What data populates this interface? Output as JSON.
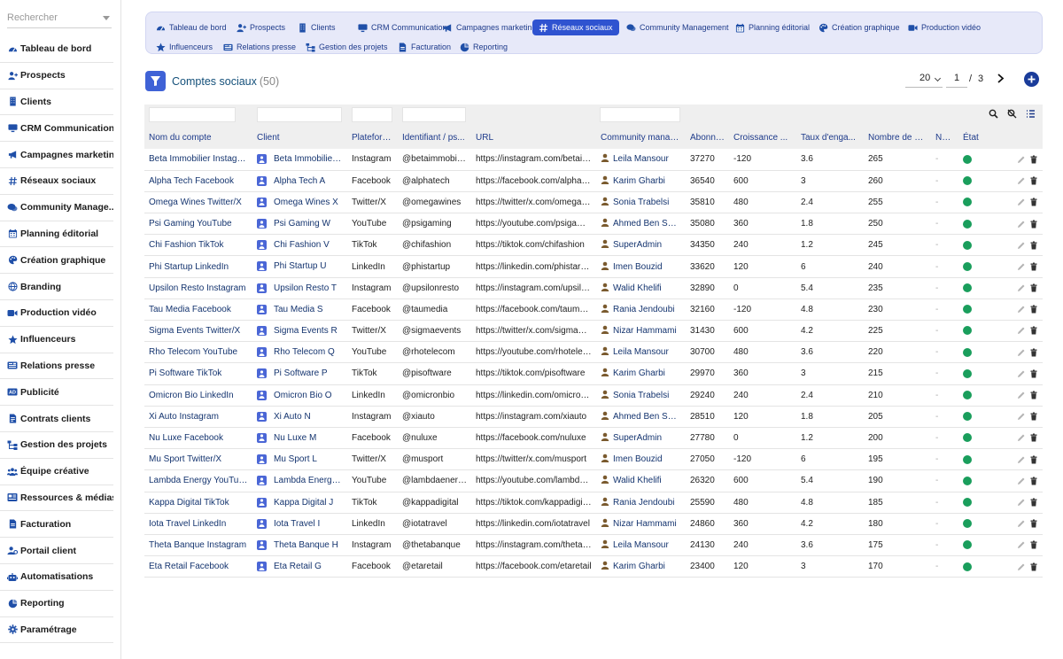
{
  "sidebar": {
    "search_placeholder": "Rechercher",
    "items": [
      {
        "label": "Tableau de bord",
        "icon": "dashboard-icon"
      },
      {
        "label": "Prospects",
        "icon": "user-plus-icon"
      },
      {
        "label": "Clients",
        "icon": "building-icon"
      },
      {
        "label": "CRM Communication",
        "icon": "monitor-icon"
      },
      {
        "label": "Campagnes marketing",
        "icon": "megaphone-icon"
      },
      {
        "label": "Réseaux sociaux",
        "icon": "hashtag-icon"
      },
      {
        "label": "Community Manage...",
        "icon": "chat-icon"
      },
      {
        "label": "Planning éditorial",
        "icon": "calendar-icon"
      },
      {
        "label": "Création graphique",
        "icon": "palette-icon"
      },
      {
        "label": "Branding",
        "icon": "globe-icon"
      },
      {
        "label": "Production vidéo",
        "icon": "video-icon"
      },
      {
        "label": "Influenceurs",
        "icon": "star-icon"
      },
      {
        "label": "Relations presse",
        "icon": "newspaper-icon"
      },
      {
        "label": "Publicité",
        "icon": "ad-icon"
      },
      {
        "label": "Contrats clients",
        "icon": "contract-icon"
      },
      {
        "label": "Gestion des projets",
        "icon": "project-icon"
      },
      {
        "label": "Équipe créative",
        "icon": "team-icon"
      },
      {
        "label": "Ressources & médias",
        "icon": "media-icon"
      },
      {
        "label": "Facturation",
        "icon": "invoice-icon"
      },
      {
        "label": "Portail client",
        "icon": "portal-icon"
      },
      {
        "label": "Automatisations",
        "icon": "robot-icon"
      },
      {
        "label": "Reporting",
        "icon": "chart-pie-icon"
      },
      {
        "label": "Paramétrage",
        "icon": "gear-icon"
      }
    ]
  },
  "modules": [
    {
      "label": "Tableau de bord",
      "icon": "dashboard-icon",
      "active": false
    },
    {
      "label": "Prospects",
      "icon": "user-plus-icon",
      "active": false
    },
    {
      "label": "Clients",
      "icon": "building-icon",
      "active": false
    },
    {
      "label": "CRM Communication",
      "icon": "monitor-icon",
      "active": false
    },
    {
      "label": "Campagnes marketing",
      "icon": "megaphone-icon",
      "active": false
    },
    {
      "label": "Réseaux sociaux",
      "icon": "hashtag-icon",
      "active": true
    },
    {
      "label": "Community Management",
      "icon": "chat-icon",
      "active": false
    },
    {
      "label": "Planning éditorial",
      "icon": "calendar-icon",
      "active": false
    },
    {
      "label": "Création graphique",
      "icon": "palette-icon",
      "active": false
    },
    {
      "label": "Production vidéo",
      "icon": "video-icon",
      "active": false
    },
    {
      "label": "Influenceurs",
      "icon": "star-icon",
      "active": false
    },
    {
      "label": "Relations presse",
      "icon": "newspaper-icon",
      "active": false
    },
    {
      "label": "Gestion des projets",
      "icon": "project-icon",
      "active": false
    },
    {
      "label": "Facturation",
      "icon": "invoice-icon",
      "active": false
    },
    {
      "label": "Reporting",
      "icon": "chart-pie-icon",
      "active": false
    }
  ],
  "header": {
    "title": "Comptes sociaux",
    "count": "(50)"
  },
  "pager": {
    "page_size": "20",
    "current_page": "1",
    "separator": "/",
    "total_pages": "3"
  },
  "table": {
    "columns": [
      "Nom du compte",
      "Client",
      "Plateforme",
      "Identifiant / ps...",
      "URL",
      "Community manager",
      "Abonnés",
      "Croissance ...",
      "Taux d'enga...",
      "Nombre de p...",
      "Note",
      "État"
    ],
    "rows": [
      {
        "name": "Beta Immobilier Instagram",
        "client": "Beta Immobilier B",
        "platform": "Instagram",
        "handle": "@betaimmobilier",
        "url": "https://instagram.com/betaimmobilier",
        "manager": "Leila Mansour",
        "followers": "37270",
        "growth": "-120",
        "engagement": "3.6",
        "posts": "265",
        "note": "-"
      },
      {
        "name": "Alpha Tech Facebook",
        "client": "Alpha Tech A",
        "platform": "Facebook",
        "handle": "@alphatech",
        "url": "https://facebook.com/alphatech",
        "manager": "Karim Gharbi",
        "followers": "36540",
        "growth": "600",
        "engagement": "3",
        "posts": "260",
        "note": "-"
      },
      {
        "name": "Omega Wines Twitter/X",
        "client": "Omega Wines X",
        "platform": "Twitter/X",
        "handle": "@omegawines",
        "url": "https://twitter/x.com/omegawines",
        "manager": "Sonia Trabelsi",
        "followers": "35810",
        "growth": "480",
        "engagement": "2.4",
        "posts": "255",
        "note": "-"
      },
      {
        "name": "Psi Gaming YouTube",
        "client": "Psi Gaming W",
        "platform": "YouTube",
        "handle": "@psigaming",
        "url": "https://youtube.com/psigaming",
        "manager": "Ahmed Ben Salah",
        "followers": "35080",
        "growth": "360",
        "engagement": "1.8",
        "posts": "250",
        "note": "-"
      },
      {
        "name": "Chi Fashion TikTok",
        "client": "Chi Fashion V",
        "platform": "TikTok",
        "handle": "@chifashion",
        "url": "https://tiktok.com/chifashion",
        "manager": "SuperAdmin",
        "followers": "34350",
        "growth": "240",
        "engagement": "1.2",
        "posts": "245",
        "note": "-"
      },
      {
        "name": "Phi Startup LinkedIn",
        "client": "Phi Startup U",
        "platform": "LinkedIn",
        "handle": "@phistartup",
        "url": "https://linkedin.com/phistartup",
        "manager": "Imen Bouzid",
        "followers": "33620",
        "growth": "120",
        "engagement": "6",
        "posts": "240",
        "note": "-"
      },
      {
        "name": "Upsilon Resto Instagram",
        "client": "Upsilon Resto T",
        "platform": "Instagram",
        "handle": "@upsilonresto",
        "url": "https://instagram.com/upsilonresto",
        "manager": "Walid Khelifi",
        "followers": "32890",
        "growth": "0",
        "engagement": "5.4",
        "posts": "235",
        "note": "-"
      },
      {
        "name": "Tau Media Facebook",
        "client": "Tau Media S",
        "platform": "Facebook",
        "handle": "@taumedia",
        "url": "https://facebook.com/taumedia",
        "manager": "Rania Jendoubi",
        "followers": "32160",
        "growth": "-120",
        "engagement": "4.8",
        "posts": "230",
        "note": "-"
      },
      {
        "name": "Sigma Events Twitter/X",
        "client": "Sigma Events R",
        "platform": "Twitter/X",
        "handle": "@sigmaevents",
        "url": "https://twitter/x.com/sigmaevents",
        "manager": "Nizar Hammami",
        "followers": "31430",
        "growth": "600",
        "engagement": "4.2",
        "posts": "225",
        "note": "-"
      },
      {
        "name": "Rho Telecom YouTube",
        "client": "Rho Telecom Q",
        "platform": "YouTube",
        "handle": "@rhotelecom",
        "url": "https://youtube.com/rhotelecom",
        "manager": "Leila Mansour",
        "followers": "30700",
        "growth": "480",
        "engagement": "3.6",
        "posts": "220",
        "note": "-"
      },
      {
        "name": "Pi Software TikTok",
        "client": "Pi Software P",
        "platform": "TikTok",
        "handle": "@pisoftware",
        "url": "https://tiktok.com/pisoftware",
        "manager": "Karim Gharbi",
        "followers": "29970",
        "growth": "360",
        "engagement": "3",
        "posts": "215",
        "note": "-"
      },
      {
        "name": "Omicron Bio LinkedIn",
        "client": "Omicron Bio O",
        "platform": "LinkedIn",
        "handle": "@omicronbio",
        "url": "https://linkedin.com/omicronbio",
        "manager": "Sonia Trabelsi",
        "followers": "29240",
        "growth": "240",
        "engagement": "2.4",
        "posts": "210",
        "note": "-"
      },
      {
        "name": "Xi Auto Instagram",
        "client": "Xi Auto N",
        "platform": "Instagram",
        "handle": "@xiauto",
        "url": "https://instagram.com/xiauto",
        "manager": "Ahmed Ben Salah",
        "followers": "28510",
        "growth": "120",
        "engagement": "1.8",
        "posts": "205",
        "note": "-"
      },
      {
        "name": "Nu Luxe Facebook",
        "client": "Nu Luxe M",
        "platform": "Facebook",
        "handle": "@nuluxe",
        "url": "https://facebook.com/nuluxe",
        "manager": "SuperAdmin",
        "followers": "27780",
        "growth": "0",
        "engagement": "1.2",
        "posts": "200",
        "note": "-"
      },
      {
        "name": "Mu Sport Twitter/X",
        "client": "Mu Sport L",
        "platform": "Twitter/X",
        "handle": "@musport",
        "url": "https://twitter/x.com/musport",
        "manager": "Imen Bouzid",
        "followers": "27050",
        "growth": "-120",
        "engagement": "6",
        "posts": "195",
        "note": "-"
      },
      {
        "name": "Lambda Energy YouTube",
        "client": "Lambda Energy K",
        "platform": "YouTube",
        "handle": "@lambdaenergy",
        "url": "https://youtube.com/lambdaenergy",
        "manager": "Walid Khelifi",
        "followers": "26320",
        "growth": "600",
        "engagement": "5.4",
        "posts": "190",
        "note": "-"
      },
      {
        "name": "Kappa Digital TikTok",
        "client": "Kappa Digital J",
        "platform": "TikTok",
        "handle": "@kappadigital",
        "url": "https://tiktok.com/kappadigital",
        "manager": "Rania Jendoubi",
        "followers": "25590",
        "growth": "480",
        "engagement": "4.8",
        "posts": "185",
        "note": "-"
      },
      {
        "name": "Iota Travel LinkedIn",
        "client": "Iota Travel I",
        "platform": "LinkedIn",
        "handle": "@iotatravel",
        "url": "https://linkedin.com/iotatravel",
        "manager": "Nizar Hammami",
        "followers": "24860",
        "growth": "360",
        "engagement": "4.2",
        "posts": "180",
        "note": "-"
      },
      {
        "name": "Theta Banque Instagram",
        "client": "Theta Banque H",
        "platform": "Instagram",
        "handle": "@thetabanque",
        "url": "https://instagram.com/thetabanque",
        "manager": "Leila Mansour",
        "followers": "24130",
        "growth": "240",
        "engagement": "3.6",
        "posts": "175",
        "note": "-"
      },
      {
        "name": "Eta Retail Facebook",
        "client": "Eta Retail G",
        "platform": "Facebook",
        "handle": "@etaretail",
        "url": "https://facebook.com/etaretail",
        "manager": "Karim Gharbi",
        "followers": "23400",
        "growth": "120",
        "engagement": "3",
        "posts": "170",
        "note": "-"
      }
    ]
  },
  "colors": {
    "accent": "#2f53d0",
    "link": "#14346f",
    "status_ok": "#1a9e5c"
  }
}
